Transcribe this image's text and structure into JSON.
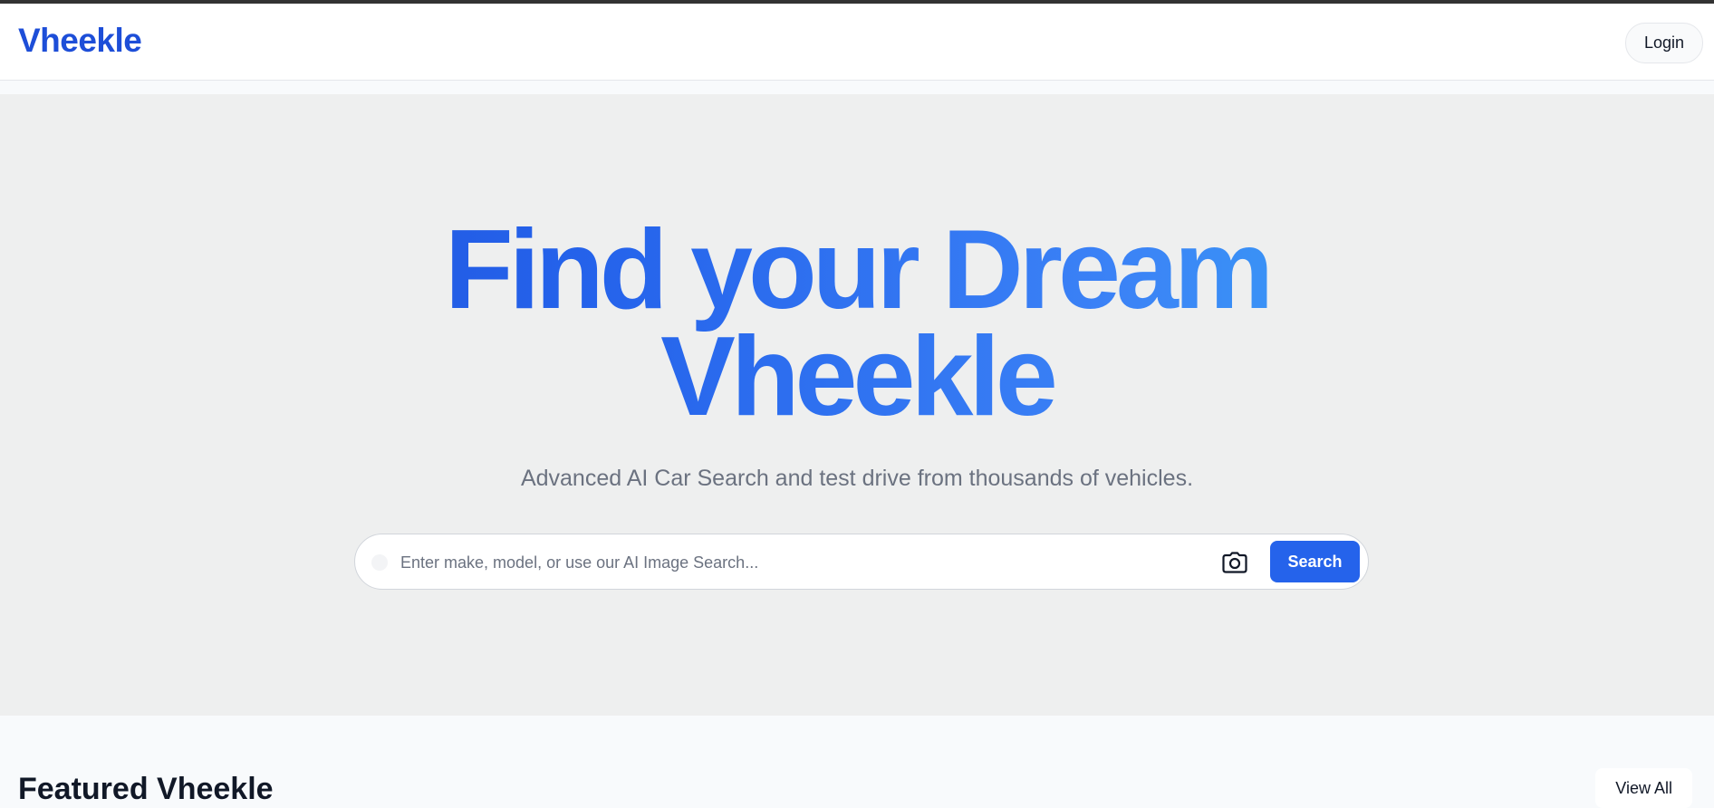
{
  "header": {
    "logo": "Vheekle",
    "login_label": "Login"
  },
  "hero": {
    "title_line1": "Find your Dream",
    "title_line2": "Vheekle",
    "subtitle": "Advanced AI Car Search and test drive from thousands of vehicles."
  },
  "search": {
    "placeholder": "Enter make, model, or use our AI Image Search...",
    "value": "",
    "button_label": "Search",
    "camera_icon": "camera-icon"
  },
  "featured": {
    "title": "Featured Vheekle",
    "view_all_label": "View All"
  },
  "colors": {
    "brand": "#1d4ed8",
    "accent": "#2563eb",
    "gradient_end": "#38bdf8"
  }
}
